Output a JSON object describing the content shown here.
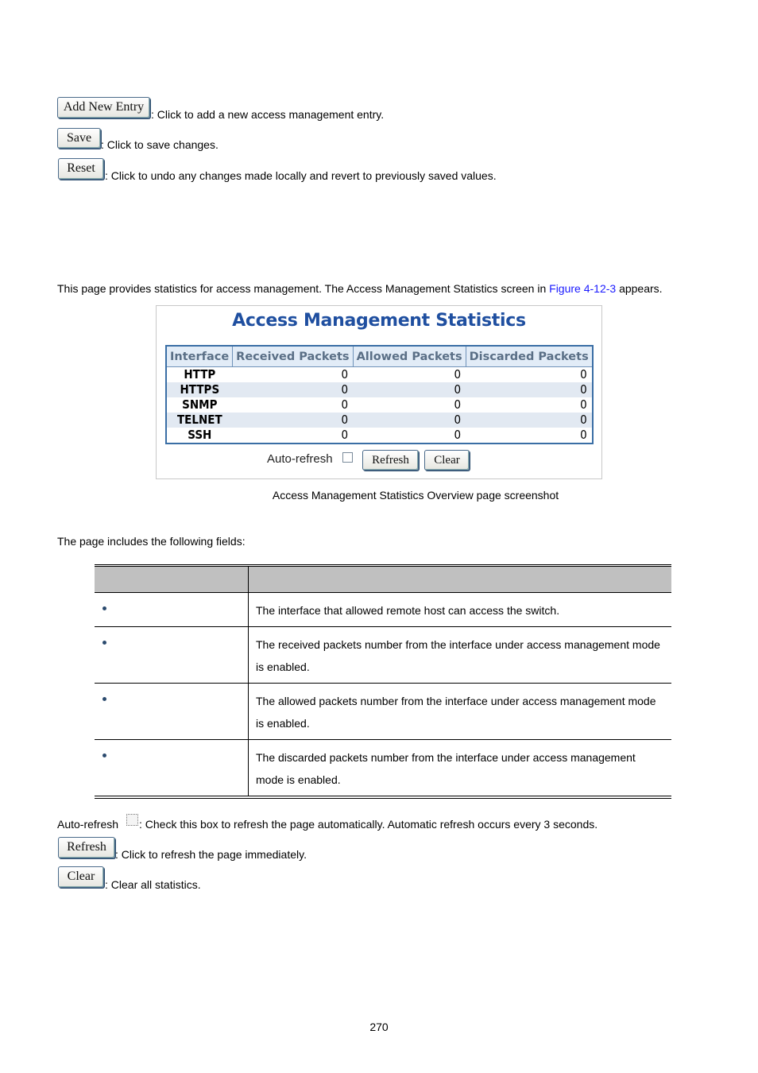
{
  "top_buttons": [
    {
      "label": "Add New Entry",
      "description": ": Click to add a new access management entry."
    },
    {
      "label": "Save",
      "description": ": Click to save changes."
    },
    {
      "label": "Reset",
      "description": ": Click to undo any changes made locally and revert to previously saved values."
    }
  ],
  "intro": {
    "text_before": "This page provides statistics for access management. The Access Management Statistics screen in ",
    "link": "Figure 4-12-3",
    "text_after": " appears."
  },
  "screenshot": {
    "title": "Access Management Statistics",
    "columns": [
      "Interface",
      "Received Packets",
      "Allowed Packets",
      "Discarded Packets"
    ],
    "rows": [
      {
        "interface": "HTTP",
        "received": "0",
        "allowed": "0",
        "discarded": "0"
      },
      {
        "interface": "HTTPS",
        "received": "0",
        "allowed": "0",
        "discarded": "0"
      },
      {
        "interface": "SNMP",
        "received": "0",
        "allowed": "0",
        "discarded": "0"
      },
      {
        "interface": "TELNET",
        "received": "0",
        "allowed": "0",
        "discarded": "0"
      },
      {
        "interface": "SSH",
        "received": "0",
        "allowed": "0",
        "discarded": "0"
      }
    ],
    "auto_refresh_label": "Auto-refresh",
    "auto_refresh_checked": false,
    "refresh_label": "Refresh",
    "clear_label": "Clear"
  },
  "caption": "Access Management Statistics Overview page screenshot",
  "fields_intro": "The page includes the following fields:",
  "fields_table": {
    "headers": [
      "",
      ""
    ],
    "rows": [
      {
        "object": "",
        "description": "The interface that allowed remote host can access the switch."
      },
      {
        "object": "",
        "description": "The received packets number from the interface under access management mode is enabled."
      },
      {
        "object": "",
        "description": "The allowed packets number from the interface under access management mode is enabled."
      },
      {
        "object": "",
        "description": "The discarded packets number from the interface under access management mode is enabled."
      }
    ]
  },
  "bottom": {
    "auto_refresh_label": "Auto-refresh",
    "auto_refresh_desc": ": Check this box to refresh the page automatically. Automatic refresh occurs every 3 seconds.",
    "refresh_label": "Refresh",
    "refresh_desc": ": Click to refresh the page immediately.",
    "clear_label": "Clear",
    "clear_desc": ": Clear all statistics."
  },
  "page_number": "270"
}
